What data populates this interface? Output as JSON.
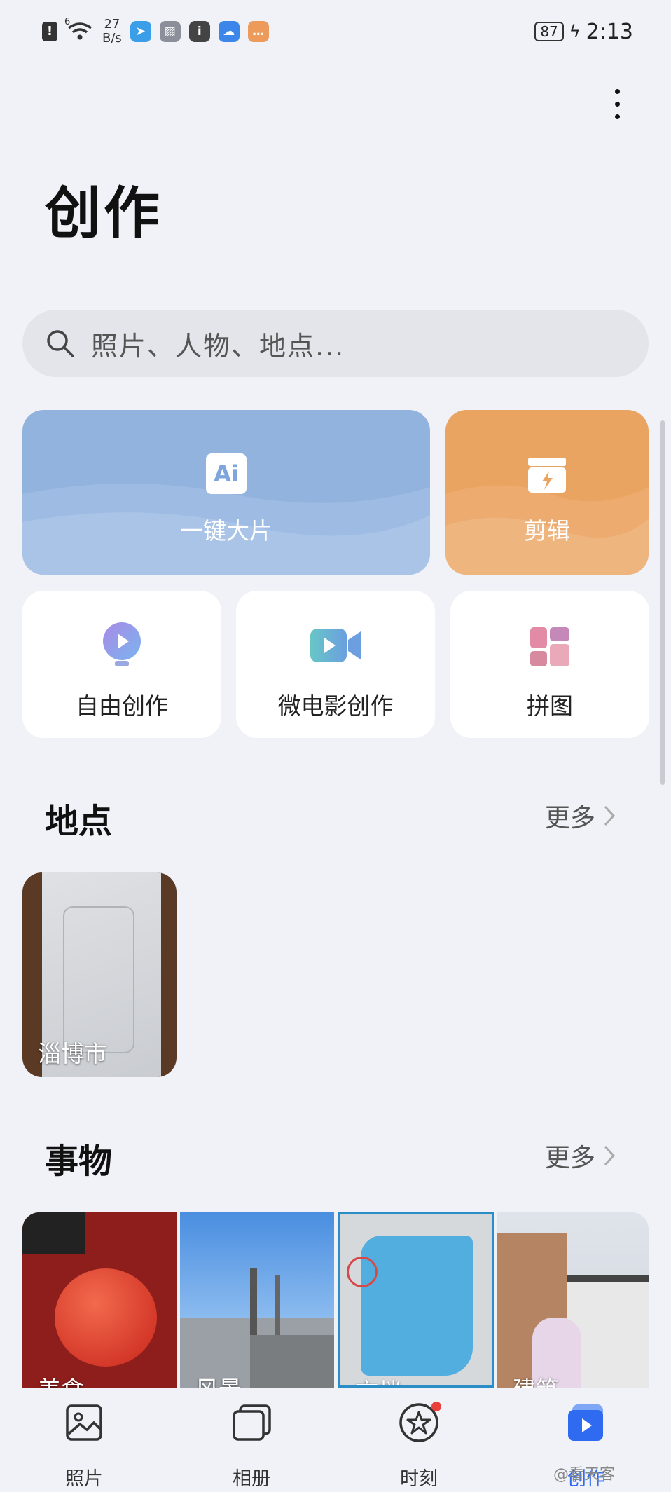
{
  "status_bar": {
    "alert": "!",
    "network_speed_value": "27",
    "network_speed_unit": "B/s",
    "signal_badge": "6",
    "battery": "87",
    "time": "2:13"
  },
  "page": {
    "title": "创作"
  },
  "search": {
    "placeholder": "照片、人物、地点..."
  },
  "tools": {
    "ai_card": {
      "label": "一键大片",
      "icon_text": "Ai"
    },
    "edit_card": {
      "label": "剪辑"
    },
    "free_create": {
      "label": "自由创作"
    },
    "micro_movie": {
      "label": "微电影创作"
    },
    "collage": {
      "label": "拼图"
    }
  },
  "places": {
    "title": "地点",
    "more": "更多",
    "items": [
      {
        "label": "淄博市"
      }
    ]
  },
  "things": {
    "title": "事物",
    "more": "更多",
    "items": [
      {
        "label": "美食"
      },
      {
        "label": "风景"
      },
      {
        "label": "文档"
      },
      {
        "label": "建筑"
      }
    ]
  },
  "tabbar": {
    "photos": "照片",
    "albums": "相册",
    "moments": "时刻",
    "create": "创作"
  },
  "watermark": "@看天客",
  "colors": {
    "background": "#f1f2f7",
    "ai_card": "#93b3df",
    "edit_card": "#eaa461",
    "active_tab": "#2f6bf0",
    "badge": "#e8413c"
  }
}
